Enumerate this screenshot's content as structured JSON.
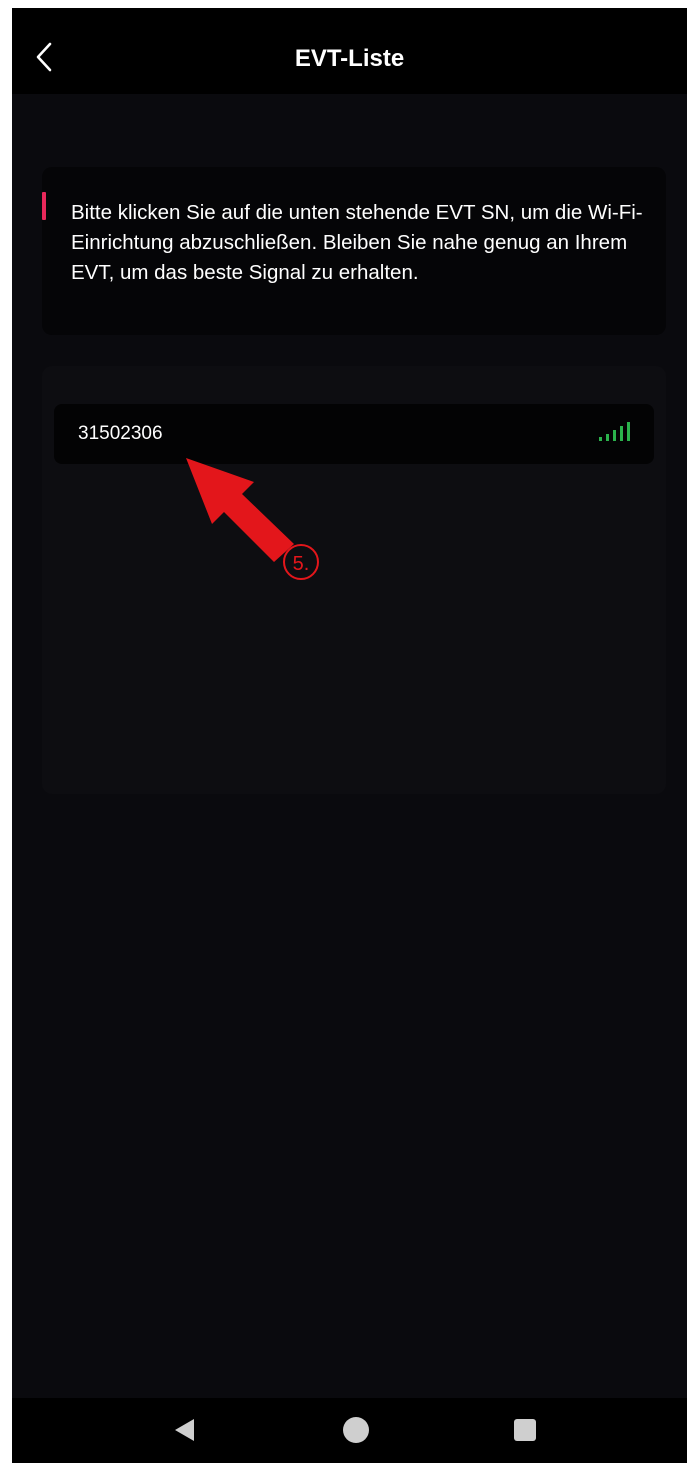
{
  "header": {
    "back_icon": "chevron-left-icon",
    "title": "EVT-Liste"
  },
  "info": {
    "text": "Bitte klicken Sie auf die unten stehende EVT SN, um die Wi-Fi-Einrichtung abzuschließen. Bleiben Sie nahe genug an Ihrem EVT, um das beste Signal zu erhalten.",
    "accent_color": "#e8285a"
  },
  "devices": [
    {
      "sn": "31502306",
      "signal_icon": "signal-strength-icon",
      "signal_bars": 5,
      "signal_max": 5,
      "signal_color": "#2bb24c"
    }
  ],
  "annotation": {
    "step_label": "5.",
    "arrow_icon": "red-arrow-icon",
    "color": "#e3161b"
  },
  "navbar": {
    "back_icon": "triangle-back-icon",
    "home_icon": "circle-home-icon",
    "recents_icon": "square-recents-icon"
  }
}
